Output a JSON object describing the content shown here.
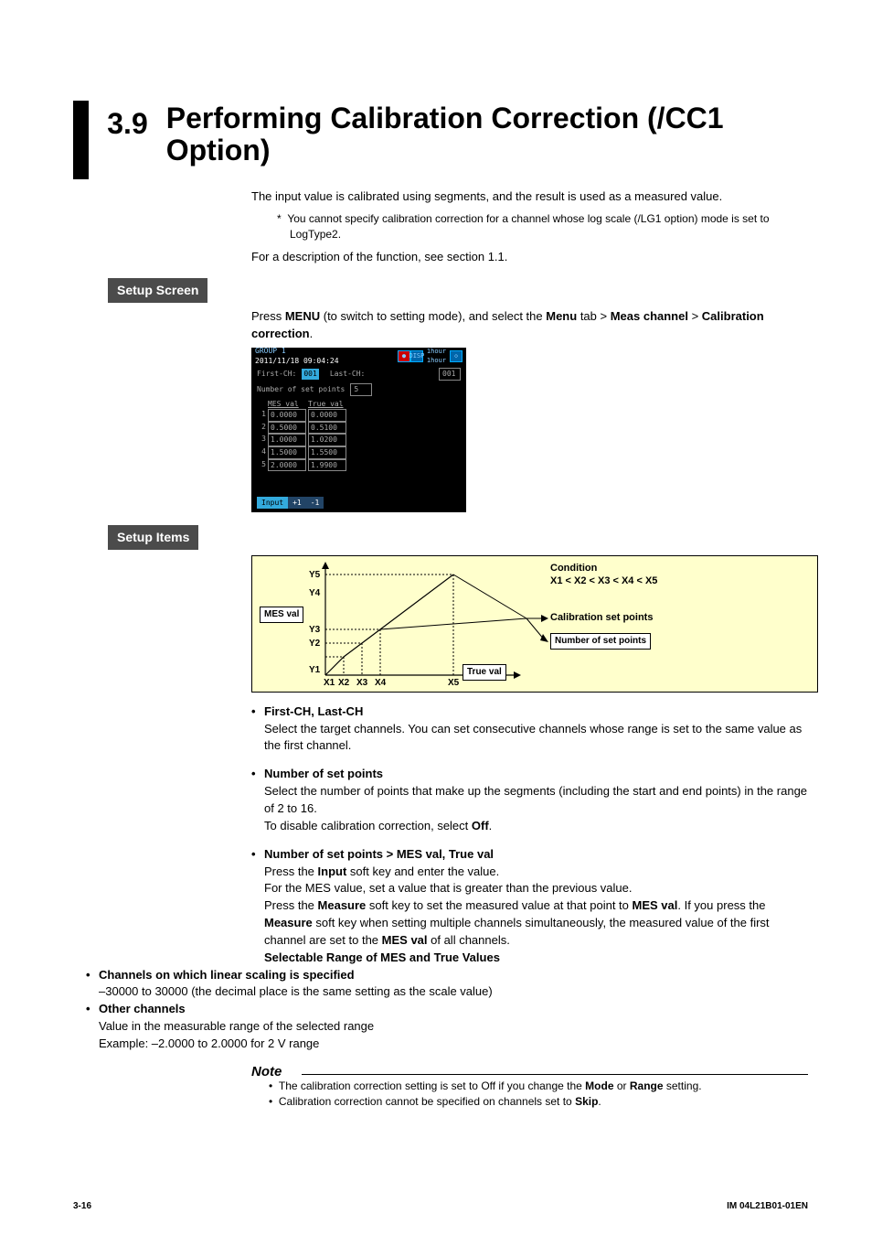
{
  "section_number": "3.9",
  "section_title": "Performing Calibration Correction (/CC1 Option)",
  "intro_text": "The input value is calibrated using segments, and the result is used as a measured value.",
  "footnote_star": "*",
  "footnote_text": "You cannot specify calibration correction for a channel whose log scale (/LG1 option) mode is set to LogType2.",
  "see_section": "For a description of the function, see section 1.1.",
  "setup_screen_label": "Setup Screen",
  "setup_items_label": "Setup Items",
  "press_menu_1": "Press ",
  "press_menu_bold1": "MENU",
  "press_menu_2": " (to switch to setting mode), and select the ",
  "press_menu_bold2": "Menu",
  "press_menu_3": " tab > ",
  "press_menu_bold3": "Meas channel",
  "press_menu_4": " > ",
  "press_menu_bold4": "Calibration correction",
  "press_menu_5": ".",
  "screenshot": {
    "group": "GROUP 1",
    "datetime": "2011/11/18 09:04:24",
    "disp": "DISP",
    "event": "EVENT",
    "hour1": "1hour",
    "hour2": "1hour",
    "first_ch_label": "First-CH:",
    "first_ch_val": "001",
    "last_ch_label": "Last-CH:",
    "last_ch_val": "001",
    "num_label": "Number of set points",
    "num_val": "5",
    "col1": "MES val",
    "col2": "True val",
    "rows": [
      {
        "i": "1",
        "a": "0.0000",
        "b": "0.0000"
      },
      {
        "i": "2",
        "a": "0.5000",
        "b": "0.5100"
      },
      {
        "i": "3",
        "a": "1.0000",
        "b": "1.0200"
      },
      {
        "i": "4",
        "a": "1.5000",
        "b": "1.5500"
      },
      {
        "i": "5",
        "a": "2.0000",
        "b": "1.9900"
      }
    ],
    "btn_input": "Input",
    "btn_plus": "+1",
    "btn_minus": "-1"
  },
  "diagram": {
    "mes_val": "MES val",
    "true_val": "True val",
    "y1": "Y1",
    "y2": "Y2",
    "y3": "Y3",
    "y4": "Y4",
    "y5": "Y5",
    "x1": "X1",
    "x2": "X2",
    "x3": "X3",
    "x4": "X4",
    "x5": "X5",
    "condition_label": "Condition",
    "condition_text": "X1 < X2 < X3 < X4 < X5",
    "calib_points": "Calibration set points",
    "num_points_box": "Number of set points"
  },
  "items": {
    "first_last_h": "First-CH, Last-CH",
    "first_last_b": "Select the target channels. You can set consecutive channels whose range is set to the same value as the first channel.",
    "num_h": "Number of set points",
    "num_b1": "Select the number of points that make up the segments (including the start and end points) in the range of 2 to 16.",
    "num_b2a": "To disable calibration correction, select ",
    "num_b2b": "Off",
    "num_b2c": ".",
    "mes_h": "Number of set points > MES val, True val",
    "mes_b1a": "Press the ",
    "mes_b1b": "Input",
    "mes_b1c": " soft key and enter the value.",
    "mes_b2": "For the MES value, set a value that is greater than the previous value.",
    "mes_b3a": "Press the ",
    "mes_b3b": "Measure",
    "mes_b3c": " soft key to set the measured value at that point to ",
    "mes_b3d": "MES val",
    "mes_b3e": ". If you press the ",
    "mes_b3f": "Measure",
    "mes_b3g": " soft key when setting multiple channels simultaneously, the measured value of the first channel are set to the ",
    "mes_b3h": "MES val",
    "mes_b3i": " of all channels.",
    "range_h": "Selectable Range of MES and True Values",
    "linear_h": "Channels on which linear scaling is specified",
    "linear_b": "–30000 to 30000 (the decimal place is the same setting as the scale value)",
    "other_h": "Other channels",
    "other_b1": "Value in the measurable range of the selected range",
    "other_b2": "Example: –2.0000 to 2.0000 for 2 V range"
  },
  "note_label": "Note",
  "note1a": "The calibration correction setting is set to Off if you change the ",
  "note1b": "Mode",
  "note1c": " or ",
  "note1d": "Range",
  "note1e": " setting.",
  "note2a": "Calibration correction cannot be specified on channels set to ",
  "note2b": "Skip",
  "note2c": ".",
  "footer_left": "3-16",
  "footer_right": "IM 04L21B01-01EN"
}
